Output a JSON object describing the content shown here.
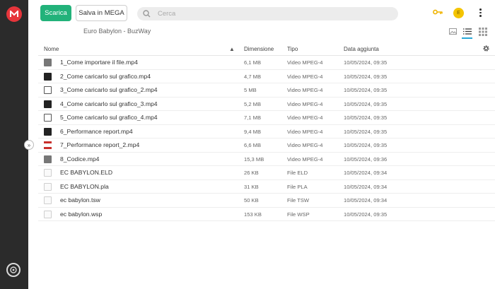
{
  "toolbar": {
    "download_label": "Scarica",
    "save_label": "Salva in MEGA"
  },
  "search": {
    "placeholder": "Cerca"
  },
  "user": {
    "initial": "E"
  },
  "breadcrumb": "Euro Babylon - BuzWay",
  "table": {
    "headers": {
      "name": "Nome",
      "size": "Dimensione",
      "type": "Tipo",
      "date": "Data aggiunta"
    },
    "sort": "ascending-name",
    "rows": [
      {
        "name": "1_Come importare il file.mp4",
        "size": "6,1 MB",
        "type": "Video MPEG-4",
        "date": "10/05/2024, 09:35",
        "icon": "video-thumb-gray"
      },
      {
        "name": "2_Come caricarlo sul grafico.mp4",
        "size": "4,7 MB",
        "type": "Video MPEG-4",
        "date": "10/05/2024, 09:35",
        "icon": "video-thumb-dark"
      },
      {
        "name": "3_Come caricarlo sul grafico_2.mp4",
        "size": "5 MB",
        "type": "Video MPEG-4",
        "date": "10/05/2024, 09:35",
        "icon": "video-thumb-light"
      },
      {
        "name": "4_Come caricarlo sul grafico_3.mp4",
        "size": "5,2 MB",
        "type": "Video MPEG-4",
        "date": "10/05/2024, 09:35",
        "icon": "video-thumb-dark"
      },
      {
        "name": "5_Come caricarlo sul grafico_4.mp4",
        "size": "7,1 MB",
        "type": "Video MPEG-4",
        "date": "10/05/2024, 09:35",
        "icon": "video-thumb-light"
      },
      {
        "name": "6_Performance report.mp4",
        "size": "9,4 MB",
        "type": "Video MPEG-4",
        "date": "10/05/2024, 09:35",
        "icon": "video-thumb-dark"
      },
      {
        "name": "7_Performance report_2.mp4",
        "size": "6,6 MB",
        "type": "Video MPEG-4",
        "date": "10/05/2024, 09:35",
        "icon": "video-thumb-red"
      },
      {
        "name": "8_Codice.mp4",
        "size": "15,3 MB",
        "type": "Video MPEG-4",
        "date": "10/05/2024, 09:36",
        "icon": "video-thumb-gray"
      },
      {
        "name": "EC BABYLON.ELD",
        "size": "26 KB",
        "type": "File ELD",
        "date": "10/05/2024, 09:34",
        "icon": "generic-file"
      },
      {
        "name": "EC BABYLON.pla",
        "size": "31 KB",
        "type": "File PLA",
        "date": "10/05/2024, 09:34",
        "icon": "generic-file"
      },
      {
        "name": "ec babylon.tsw",
        "size": "50 KB",
        "type": "File TSW",
        "date": "10/05/2024, 09:34",
        "icon": "generic-file"
      },
      {
        "name": "ec babylon.wsp",
        "size": "153 KB",
        "type": "File WSP",
        "date": "10/05/2024, 09:35",
        "icon": "generic-file"
      }
    ]
  },
  "colors": {
    "sidebar": "#2b2b2b",
    "brand": "#e6353b",
    "download_button": "#22b27a",
    "avatar": "#f4c400",
    "active_view": "#27a8d8"
  }
}
